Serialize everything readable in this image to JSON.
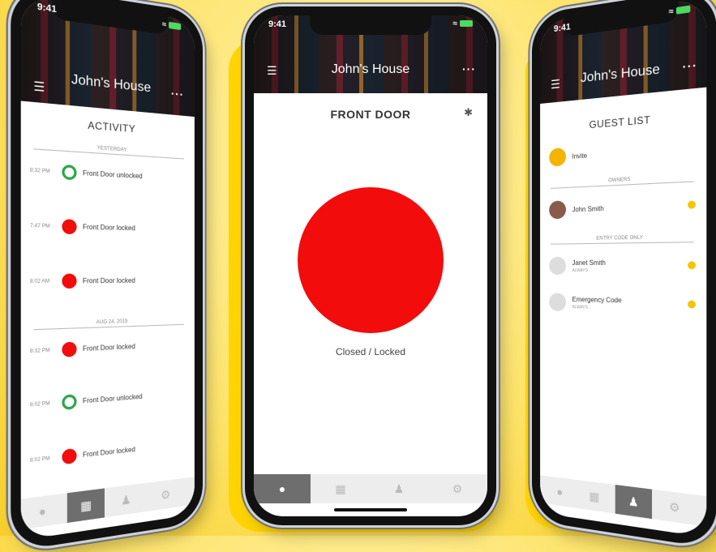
{
  "center_phone": {
    "status_time": "9:41",
    "house_title": "John's House",
    "door_title": "FRONT DOOR",
    "lock_status": "Closed / Locked",
    "lock_color": "#f20c0c"
  },
  "left_phone": {
    "status_time": "9:41",
    "house_title": "John's House",
    "section_title": "ACTIVITY",
    "groups": [
      {
        "date": "YESTERDAY",
        "events": [
          {
            "time": "8:32 PM",
            "label": "Front Door unlocked",
            "state": "unlocked"
          },
          {
            "time": "7:47 PM",
            "label": "Front Door locked",
            "state": "locked"
          },
          {
            "time": "8:02 AM",
            "label": "Front Door locked",
            "state": "locked"
          }
        ]
      },
      {
        "date": "AUG 24, 2019",
        "events": [
          {
            "time": "8:32 PM",
            "label": "Front Door locked",
            "state": "locked"
          },
          {
            "time": "8:02 PM",
            "label": "Front Door unlocked",
            "state": "unlocked"
          },
          {
            "time": "8:02 PM",
            "label": "Front Door locked",
            "state": "locked"
          }
        ]
      }
    ]
  },
  "right_phone": {
    "status_time": "9:41",
    "house_title": "John's House",
    "section_title": "GUEST LIST",
    "invite_label": "Invite",
    "owners_heading": "OWNERS",
    "entry_heading": "ENTRY CODE ONLY",
    "owner": {
      "name": "John Smith"
    },
    "entry_guests": [
      {
        "name": "Janet Smith",
        "sub": "ALWAYS"
      },
      {
        "name": "Emergency Code",
        "sub": "ALWAYS"
      }
    ]
  },
  "colors": {
    "background": "#fde36a",
    "accent_yellow": "#ffd400",
    "locked_red": "#f20c0c",
    "unlocked_green": "#29a744",
    "guest_dot": "#f5c400"
  }
}
